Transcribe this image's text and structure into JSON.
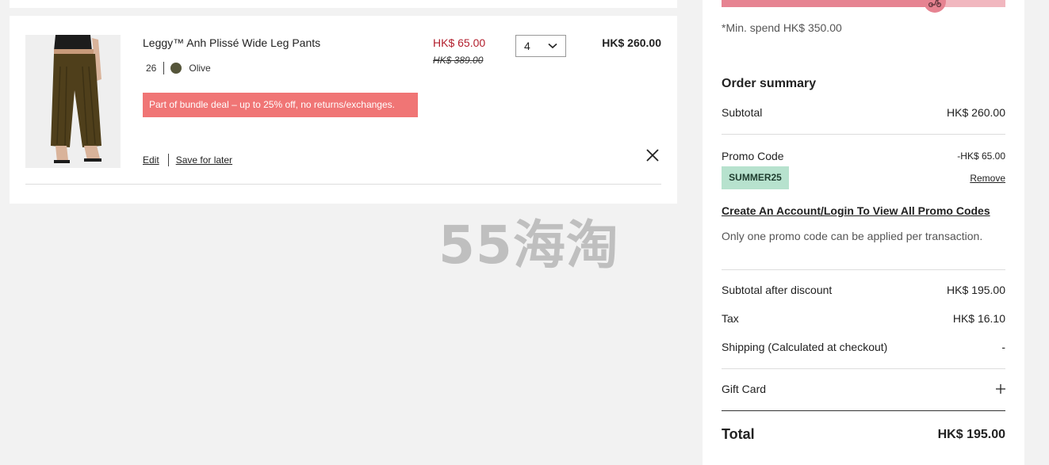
{
  "cart": {
    "item": {
      "name": "Leggy™ Anh Plissé Wide Leg Pants",
      "size": "26",
      "color_name": "Olive",
      "color_hex": "#55553a",
      "bundle_note": "Part of bundle deal – up to 25% off, no returns/exchanges.",
      "sale_price": "HK$ 65.00",
      "original_price": "HK$ 389.00",
      "quantity": "4",
      "line_total": "HK$ 260.00",
      "edit_label": "Edit",
      "save_label": "Save for later",
      "remove_icon": "close-icon"
    }
  },
  "watermark": "55海淘",
  "free_shipping": {
    "progress": 0.75,
    "min_spend_text": "*Min. spend HK$ 350.00",
    "icon": "scooter-icon"
  },
  "summary": {
    "title": "Order summary",
    "subtotal_label": "Subtotal",
    "subtotal_value": "HK$ 260.00",
    "promo_label": "Promo Code",
    "promo_discount": "-HK$ 65.00",
    "promo_code": "SUMMER25",
    "remove_label": "Remove",
    "login_link": "Create An Account/Login To View All Promo Codes",
    "promo_note": "Only one promo code can be applied per transaction.",
    "after_discount_label": "Subtotal after discount",
    "after_discount_value": "HK$ 195.00",
    "tax_label": "Tax",
    "tax_value": "HK$ 16.10",
    "shipping_label": "Shipping (Calculated at checkout)",
    "shipping_value": "-",
    "gift_card_label": "Gift Card",
    "total_label": "Total",
    "total_value": "HK$ 195.00"
  },
  "colors": {
    "sale_red": "#b21e2c",
    "bundle_badge": "#f07575",
    "promo_tag": "#b7e2ce",
    "progress_fill": "#e68391",
    "progress_track": "#f1b7bf"
  }
}
